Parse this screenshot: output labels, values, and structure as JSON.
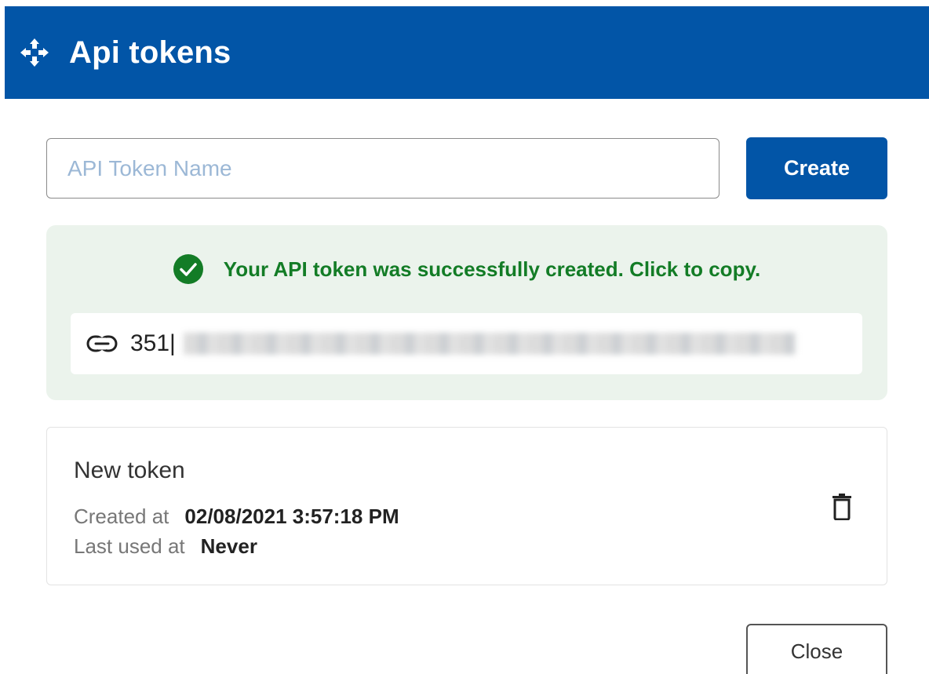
{
  "header": {
    "title": "Api tokens",
    "icon": "move-arrows-icon",
    "background": "#0255a7"
  },
  "form": {
    "name_placeholder": "API Token Name",
    "name_value": "",
    "create_label": "Create"
  },
  "success": {
    "icon": "check-circle-icon",
    "message": "Your API token was successfully created. Click to copy.",
    "token_prefix": "351|",
    "color": "#137c26",
    "background": "#ebf3ec"
  },
  "token": {
    "name": "New token",
    "created_label": "Created at",
    "created_value": "02/08/2021 3:57:18 PM",
    "last_used_label": "Last used at",
    "last_used_value": "Never",
    "delete_icon": "trash-icon"
  },
  "footer": {
    "close_label": "Close"
  }
}
